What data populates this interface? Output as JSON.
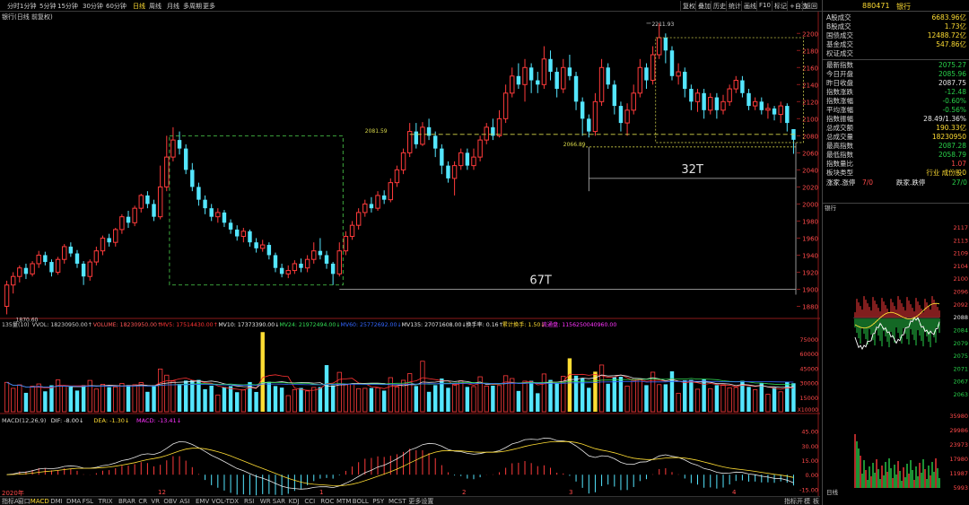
{
  "toolbar": {
    "periods": [
      "分时",
      "1分钟",
      "5分钟",
      "15分钟",
      "30分钟",
      "60分钟",
      "日线",
      "周线",
      "月线",
      "多周期",
      "更多"
    ],
    "active_period": "日线",
    "right_buttons": [
      "复权",
      "叠加",
      "历史",
      "统计",
      "画线",
      "F10",
      "标记",
      "+自选",
      "返回"
    ]
  },
  "chart_title": "银行(日线 前复权)",
  "annotations": {
    "high_label": "2211.93",
    "low_label": "1870.60",
    "level_1": "2081.59",
    "level_2": "2066.89",
    "span_32": "32T",
    "span_67": "67T"
  },
  "price_axis": [
    "2200",
    "2180",
    "2160",
    "2140",
    "2120",
    "2100",
    "2080",
    "2060",
    "2040",
    "2020",
    "2000",
    "1980",
    "1960",
    "1940",
    "1920",
    "1900",
    "1880"
  ],
  "volume_header": [
    {
      "t": "135量(10)",
      "c": "#cfcfcf"
    },
    {
      "t": "VVOL: 18230950.00↑",
      "c": "#cfcfcf"
    },
    {
      "t": "VOLUME: 18230950.00↑",
      "c": "#ff5555"
    },
    {
      "t": "MV5: 17514430.00↑",
      "c": "#ff3333"
    },
    {
      "t": "MV10: 17373390.00↓",
      "c": "#e8e8e8"
    },
    {
      "t": "MV24: 21972494.00↓",
      "c": "#33dd55"
    },
    {
      "t": "MV60: 25772692.00↓",
      "c": "#3366ff"
    },
    {
      "t": "MV135: 27071608.00↓",
      "c": "#e8e8e8"
    },
    {
      "t": "换手率: 0.16↑",
      "c": "#e8e8e8"
    },
    {
      "t": "累计换手: 1.50↓",
      "c": "#ffdd33"
    },
    {
      "t": "流通盘: 1156250040960.00",
      "c": "#ff33ff"
    }
  ],
  "volume_axis": [
    "75000",
    "60000",
    "45000",
    "30000",
    "15000"
  ],
  "volume_unit": "X10000",
  "macd_header": [
    {
      "t": "MACD(12,26,9)",
      "c": "#cfcfcf"
    },
    {
      "t": "DIF: -8.00↓",
      "c": "#e8e8e8"
    },
    {
      "t": "DEA: -1.30↓",
      "c": "#ffdd33"
    },
    {
      "t": "MACD: -13.41↓",
      "c": "#ff33ff"
    }
  ],
  "macd_axis": [
    "45.00",
    "30.00",
    "15.00",
    "0.00",
    "-15.00"
  ],
  "date_axis": [
    "2020年",
    "12",
    "1",
    "2",
    "3",
    "4"
  ],
  "panel": {
    "code": "880471",
    "name": "银行",
    "quotes": [
      {
        "l": "A股成交",
        "v": "6683.96亿",
        "c": "yel"
      },
      {
        "l": "B股成交",
        "v": "1.73亿",
        "c": "yel"
      },
      {
        "l": "国债成交",
        "v": "12488.72亿",
        "c": "yel"
      },
      {
        "l": "基金成交",
        "v": "547.86亿",
        "c": "yel"
      },
      {
        "l": "权证成交",
        "v": "",
        "c": "yel"
      }
    ],
    "stats": [
      {
        "l": "最新指数",
        "v": "2075.27",
        "c": "green"
      },
      {
        "l": "今日开盘",
        "v": "2085.96",
        "c": "green"
      },
      {
        "l": "昨日收盘",
        "v": "2087.75",
        "c": "wht"
      },
      {
        "l": "指数涨跌",
        "v": "-12.48",
        "c": "green"
      },
      {
        "l": "指数涨幅",
        "v": "-0.60%",
        "c": "green"
      },
      {
        "l": "平均涨幅",
        "v": "-0.56%",
        "c": "green"
      },
      {
        "l": "指数振幅",
        "v": "28.49/1.36%",
        "c": "wht"
      },
      {
        "l": "总成交额",
        "v": "190.33亿",
        "c": "yel"
      },
      {
        "l": "总成交量",
        "v": "18230950",
        "c": "yel"
      },
      {
        "l": "最高指数",
        "v": "2087.28",
        "c": "green"
      },
      {
        "l": "最低指数",
        "v": "2058.79",
        "c": "green"
      },
      {
        "l": "指数量比",
        "v": "1.07",
        "c": "red"
      }
    ],
    "type_row": {
      "l": "板块类型",
      "v": "行业 成份股0"
    },
    "limit_row": {
      "l1": "涨家.涨停",
      "v1": "7/0",
      "l2": "跌家.跌停",
      "v2": "27/0"
    },
    "mini_title": "银行",
    "mini_axis": [
      "2117",
      "2113",
      "2109",
      "2104",
      "2100",
      "2096",
      "2092",
      "2088",
      "2084",
      "2079",
      "2075",
      "2071",
      "2067",
      "2063"
    ],
    "mini_vol_axis": [
      "35980",
      "29986",
      "23973",
      "17980",
      "11987",
      "5993"
    ],
    "bottom_label": "日线"
  },
  "tabs": {
    "items": [
      "指标A",
      "窗口",
      "MACD",
      "DMI",
      "DMA",
      "FSL",
      "TRIX",
      "BRAR",
      "CR",
      "VR",
      "OBV",
      "ASI",
      "EMV",
      "VOL-TDX",
      "RSI",
      "WR",
      "SAR",
      "KDJ",
      "CCI",
      "ROC",
      "MTM",
      "BOLL",
      "PSY",
      "MCST",
      "更多",
      "设置"
    ],
    "active": "MACD",
    "right": [
      "指标开",
      "模",
      "板"
    ]
  },
  "chart_data": {
    "type": "candlestick",
    "candles": [
      {
        "o": 1880,
        "c": 1905,
        "h": 1910,
        "l": 1870.6
      },
      {
        "o": 1905,
        "c": 1915,
        "h": 1920,
        "l": 1895
      },
      {
        "o": 1915,
        "c": 1925,
        "h": 1928,
        "l": 1908
      },
      {
        "o": 1925,
        "c": 1918,
        "h": 1930,
        "l": 1912
      },
      {
        "o": 1918,
        "c": 1930,
        "h": 1933,
        "l": 1915
      },
      {
        "o": 1930,
        "c": 1940,
        "h": 1945,
        "l": 1925
      },
      {
        "o": 1940,
        "c": 1932,
        "h": 1944,
        "l": 1928
      },
      {
        "o": 1932,
        "c": 1920,
        "h": 1935,
        "l": 1915
      },
      {
        "o": 1920,
        "c": 1935,
        "h": 1938,
        "l": 1917
      },
      {
        "o": 1935,
        "c": 1950,
        "h": 1953,
        "l": 1930
      },
      {
        "o": 1950,
        "c": 1942,
        "h": 1955,
        "l": 1938
      },
      {
        "o": 1942,
        "c": 1930,
        "h": 1946,
        "l": 1925
      },
      {
        "o": 1930,
        "c": 1915,
        "h": 1933,
        "l": 1905
      },
      {
        "o": 1915,
        "c": 1932,
        "h": 1935,
        "l": 1910
      },
      {
        "o": 1932,
        "c": 1945,
        "h": 1950,
        "l": 1928
      },
      {
        "o": 1945,
        "c": 1960,
        "h": 1963,
        "l": 1940
      },
      {
        "o": 1960,
        "c": 1955,
        "h": 1965,
        "l": 1950
      },
      {
        "o": 1955,
        "c": 1970,
        "h": 1972,
        "l": 1950
      },
      {
        "o": 1970,
        "c": 1985,
        "h": 1988,
        "l": 1965
      },
      {
        "o": 1985,
        "c": 1978,
        "h": 1992,
        "l": 1972
      },
      {
        "o": 1978,
        "c": 1995,
        "h": 1998,
        "l": 1974
      },
      {
        "o": 1995,
        "c": 2010,
        "h": 2012,
        "l": 1990
      },
      {
        "o": 2010,
        "c": 2000,
        "h": 2015,
        "l": 1995
      },
      {
        "o": 2000,
        "c": 1985,
        "h": 2005,
        "l": 1980
      },
      {
        "o": 1985,
        "c": 2020,
        "h": 2045,
        "l": 1982
      },
      {
        "o": 2020,
        "c": 2055,
        "h": 2080,
        "l": 2015
      },
      {
        "o": 2055,
        "c": 2075,
        "h": 2090,
        "l": 2050
      },
      {
        "o": 2075,
        "c": 2065,
        "h": 2085,
        "l": 2058
      },
      {
        "o": 2065,
        "c": 2040,
        "h": 2070,
        "l": 2035
      },
      {
        "o": 2040,
        "c": 2020,
        "h": 2048,
        "l": 2015
      },
      {
        "o": 2020,
        "c": 2005,
        "h": 2025,
        "l": 1998
      },
      {
        "o": 2005,
        "c": 1995,
        "h": 2010,
        "l": 1988
      },
      {
        "o": 1995,
        "c": 1985,
        "h": 2000,
        "l": 1980
      },
      {
        "o": 1985,
        "c": 1990,
        "h": 1995,
        "l": 1978
      },
      {
        "o": 1990,
        "c": 1978,
        "h": 1993,
        "l": 1973
      },
      {
        "o": 1978,
        "c": 1970,
        "h": 1982,
        "l": 1965
      },
      {
        "o": 1970,
        "c": 1962,
        "h": 1975,
        "l": 1957
      },
      {
        "o": 1962,
        "c": 1968,
        "h": 1972,
        "l": 1955
      },
      {
        "o": 1968,
        "c": 1955,
        "h": 1970,
        "l": 1950
      },
      {
        "o": 1955,
        "c": 1948,
        "h": 1960,
        "l": 1943
      },
      {
        "o": 1948,
        "c": 1952,
        "h": 1958,
        "l": 1944
      },
      {
        "o": 1952,
        "c": 1940,
        "h": 1955,
        "l": 1935
      },
      {
        "o": 1940,
        "c": 1925,
        "h": 1943,
        "l": 1920
      },
      {
        "o": 1925,
        "c": 1918,
        "h": 1930,
        "l": 1914
      },
      {
        "o": 1918,
        "c": 1922,
        "h": 1928,
        "l": 1913
      },
      {
        "o": 1922,
        "c": 1930,
        "h": 1934,
        "l": 1918
      },
      {
        "o": 1930,
        "c": 1925,
        "h": 1936,
        "l": 1920
      },
      {
        "o": 1925,
        "c": 1935,
        "h": 1940,
        "l": 1920
      },
      {
        "o": 1935,
        "c": 1945,
        "h": 1955,
        "l": 1930
      },
      {
        "o": 1945,
        "c": 1940,
        "h": 1960,
        "l": 1935
      },
      {
        "o": 1940,
        "c": 1930,
        "h": 1945,
        "l": 1924
      },
      {
        "o": 1930,
        "c": 1918,
        "h": 1932,
        "l": 1905
      },
      {
        "o": 1918,
        "c": 1945,
        "h": 1955,
        "l": 1915
      },
      {
        "o": 1945,
        "c": 1962,
        "h": 1968,
        "l": 1940
      },
      {
        "o": 1962,
        "c": 1975,
        "h": 1980,
        "l": 1958
      },
      {
        "o": 1975,
        "c": 1990,
        "h": 1995,
        "l": 1970
      },
      {
        "o": 1990,
        "c": 2000,
        "h": 2005,
        "l": 1985
      },
      {
        "o": 2000,
        "c": 1995,
        "h": 2008,
        "l": 1990
      },
      {
        "o": 1995,
        "c": 2010,
        "h": 2015,
        "l": 1992
      },
      {
        "o": 2010,
        "c": 2005,
        "h": 2016,
        "l": 2000
      },
      {
        "o": 2005,
        "c": 2025,
        "h": 2030,
        "l": 2002
      },
      {
        "o": 2025,
        "c": 2040,
        "h": 2045,
        "l": 2020
      },
      {
        "o": 2040,
        "c": 2060,
        "h": 2065,
        "l": 2035
      },
      {
        "o": 2060,
        "c": 2085,
        "h": 2095,
        "l": 2055
      },
      {
        "o": 2085,
        "c": 2070,
        "h": 2095,
        "l": 2065
      },
      {
        "o": 2070,
        "c": 2090,
        "h": 2096,
        "l": 2068
      },
      {
        "o": 2090,
        "c": 2080,
        "h": 2100,
        "l": 2075
      },
      {
        "o": 2080,
        "c": 2065,
        "h": 2085,
        "l": 2055
      },
      {
        "o": 2065,
        "c": 2045,
        "h": 2070,
        "l": 2035
      },
      {
        "o": 2045,
        "c": 2030,
        "h": 2050,
        "l": 2025
      },
      {
        "o": 2030,
        "c": 2045,
        "h": 2050,
        "l": 2010
      },
      {
        "o": 2045,
        "c": 2060,
        "h": 2065,
        "l": 2040
      },
      {
        "o": 2060,
        "c": 2045,
        "h": 2065,
        "l": 2040
      },
      {
        "o": 2045,
        "c": 2055,
        "h": 2065,
        "l": 2040
      },
      {
        "o": 2055,
        "c": 2075,
        "h": 2080,
        "l": 2050
      },
      {
        "o": 2075,
        "c": 2090,
        "h": 2095,
        "l": 2070
      },
      {
        "o": 2090,
        "c": 2080,
        "h": 2100,
        "l": 2075
      },
      {
        "o": 2080,
        "c": 2100,
        "h": 2110,
        "l": 2078
      },
      {
        "o": 2100,
        "c": 2130,
        "h": 2140,
        "l": 2095
      },
      {
        "o": 2130,
        "c": 2150,
        "h": 2160,
        "l": 2125
      },
      {
        "o": 2150,
        "c": 2140,
        "h": 2165,
        "l": 2135
      },
      {
        "o": 2140,
        "c": 2160,
        "h": 2170,
        "l": 2120
      },
      {
        "o": 2160,
        "c": 2145,
        "h": 2165,
        "l": 2130
      },
      {
        "o": 2145,
        "c": 2140,
        "h": 2155,
        "l": 2130
      },
      {
        "o": 2140,
        "c": 2170,
        "h": 2185,
        "l": 2135
      },
      {
        "o": 2170,
        "c": 2155,
        "h": 2180,
        "l": 2145
      },
      {
        "o": 2155,
        "c": 2135,
        "h": 2160,
        "l": 2125
      },
      {
        "o": 2135,
        "c": 2160,
        "h": 2170,
        "l": 2130
      },
      {
        "o": 2160,
        "c": 2150,
        "h": 2175,
        "l": 2145
      },
      {
        "o": 2150,
        "c": 2120,
        "h": 2155,
        "l": 2110
      },
      {
        "o": 2120,
        "c": 2100,
        "h": 2125,
        "l": 2080
      },
      {
        "o": 2100,
        "c": 2085,
        "h": 2105,
        "l": 2078
      },
      {
        "o": 2085,
        "c": 2120,
        "h": 2130,
        "l": 2080
      },
      {
        "o": 2120,
        "c": 2160,
        "h": 2170,
        "l": 2115
      },
      {
        "o": 2160,
        "c": 2140,
        "h": 2165,
        "l": 2135
      },
      {
        "o": 2140,
        "c": 2115,
        "h": 2145,
        "l": 2105
      },
      {
        "o": 2115,
        "c": 2095,
        "h": 2120,
        "l": 2085
      },
      {
        "o": 2095,
        "c": 2110,
        "h": 2118,
        "l": 2080
      },
      {
        "o": 2110,
        "c": 2130,
        "h": 2140,
        "l": 2105
      },
      {
        "o": 2130,
        "c": 2160,
        "h": 2170,
        "l": 2125
      },
      {
        "o": 2160,
        "c": 2145,
        "h": 2165,
        "l": 2135
      },
      {
        "o": 2145,
        "c": 2175,
        "h": 2185,
        "l": 2140
      },
      {
        "o": 2175,
        "c": 2195,
        "h": 2211.93,
        "l": 2170
      },
      {
        "o": 2195,
        "c": 2180,
        "h": 2200,
        "l": 2165
      },
      {
        "o": 2180,
        "c": 2150,
        "h": 2185,
        "l": 2145
      },
      {
        "o": 2150,
        "c": 2155,
        "h": 2165,
        "l": 2140
      },
      {
        "o": 2155,
        "c": 2135,
        "h": 2160,
        "l": 2125
      },
      {
        "o": 2135,
        "c": 2120,
        "h": 2140,
        "l": 2110
      },
      {
        "o": 2120,
        "c": 2130,
        "h": 2135,
        "l": 2108
      },
      {
        "o": 2130,
        "c": 2110,
        "h": 2135,
        "l": 2100
      },
      {
        "o": 2110,
        "c": 2125,
        "h": 2130,
        "l": 2105
      },
      {
        "o": 2125,
        "c": 2110,
        "h": 2130,
        "l": 2100
      },
      {
        "o": 2110,
        "c": 2120,
        "h": 2128,
        "l": 2105
      },
      {
        "o": 2120,
        "c": 2135,
        "h": 2140,
        "l": 2115
      },
      {
        "o": 2135,
        "c": 2145,
        "h": 2150,
        "l": 2130
      },
      {
        "o": 2145,
        "c": 2130,
        "h": 2150,
        "l": 2125
      },
      {
        "o": 2130,
        "c": 2115,
        "h": 2135,
        "l": 2110
      },
      {
        "o": 2115,
        "c": 2120,
        "h": 2125,
        "l": 2110
      },
      {
        "o": 2120,
        "c": 2110,
        "h": 2125,
        "l": 2105
      },
      {
        "o": 2110,
        "c": 2112,
        "h": 2118,
        "l": 2100
      },
      {
        "o": 2112,
        "c": 2105,
        "h": 2115,
        "l": 2098
      },
      {
        "o": 2105,
        "c": 2115,
        "h": 2120,
        "l": 2095
      },
      {
        "o": 2115,
        "c": 2095,
        "h": 2118,
        "l": 2085
      },
      {
        "o": 2087.75,
        "c": 2075.27,
        "h": 2087.28,
        "l": 2058.79
      }
    ],
    "price_range": [
      1870,
      2215
    ]
  }
}
